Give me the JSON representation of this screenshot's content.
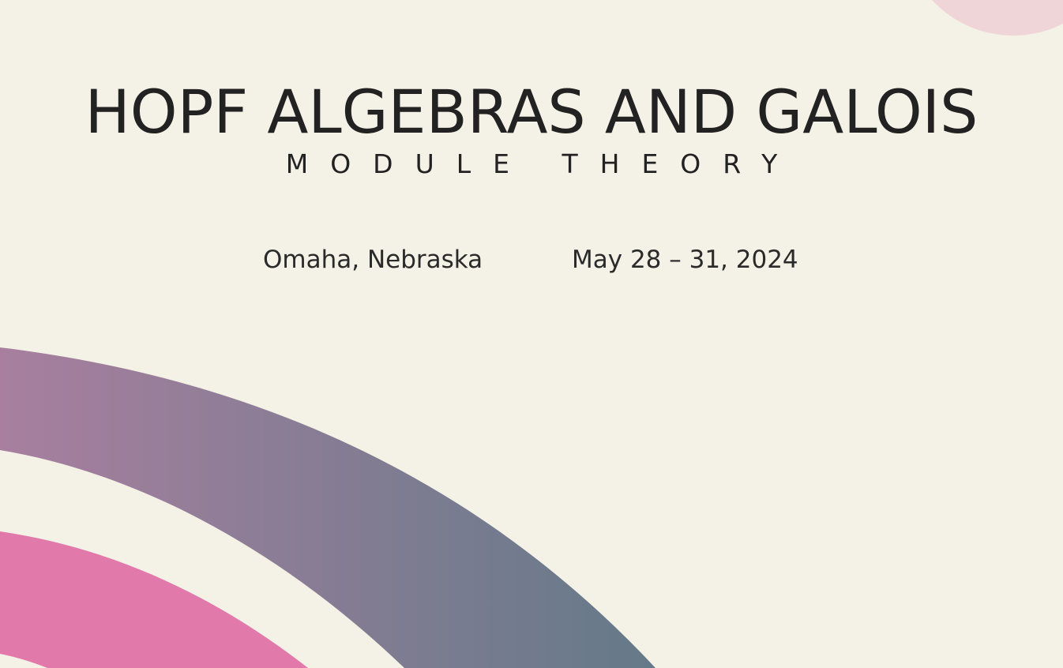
{
  "event": {
    "title": "HOPF ALGEBRAS AND GALOIS",
    "subtitle": "MODULE THEORY",
    "location": "Omaha, Nebraska",
    "dates": "May 28 – 31, 2024"
  },
  "colors": {
    "background": "#f4f1e6",
    "text": "#222222",
    "arc_gradient_start": "#a87f9f",
    "arc_gradient_end": "#647a89",
    "pink_arc": "#e279ab",
    "corner_circle": "#efd4d8"
  }
}
